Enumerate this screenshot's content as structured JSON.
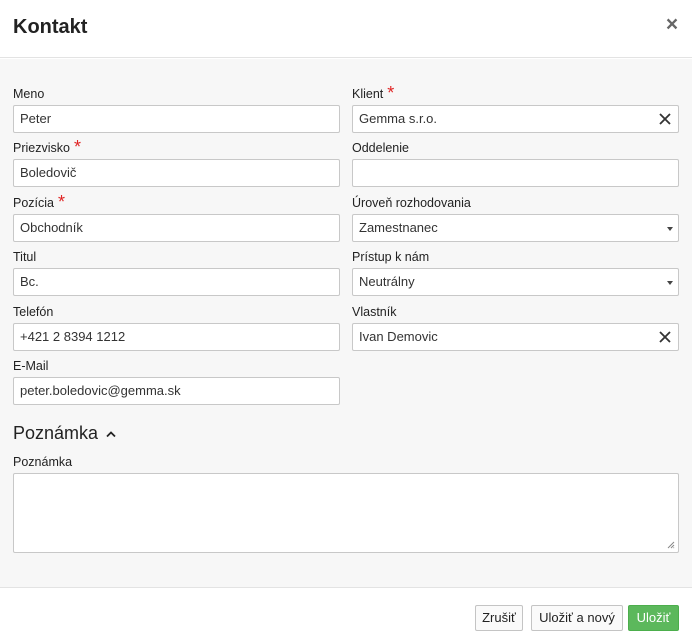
{
  "dialog": {
    "title": "Kontakt",
    "close_symbol": "×"
  },
  "form": {
    "meno": {
      "label": "Meno",
      "value": "Peter"
    },
    "klient": {
      "label": "Klient",
      "required_mark": "*",
      "value": "Gemma s.r.o."
    },
    "priezvisko": {
      "label": "Priezvisko",
      "required_mark": "*",
      "value": "Boledovič"
    },
    "oddelenie": {
      "label": "Oddelenie",
      "value": ""
    },
    "pozicia": {
      "label": "Pozícia",
      "required_mark": "*",
      "value": "Obchodník"
    },
    "uroven": {
      "label": "Úroveň rozhodovania",
      "value": "Zamestnanec"
    },
    "titul": {
      "label": "Titul",
      "value": "Bc."
    },
    "pristup": {
      "label": "Prístup k nám",
      "value": "Neutrálny"
    },
    "telefon": {
      "label": "Telefón",
      "value": "+421 2 8394 1212"
    },
    "vlastnik": {
      "label": "Vlastník",
      "value": "Ivan Demovic"
    },
    "email": {
      "label": "E-Mail",
      "value": "peter.boledovic@gemma.sk"
    }
  },
  "note_section": {
    "title": "Poznámka",
    "field_label": "Poznámka",
    "value": ""
  },
  "footer": {
    "cancel_label": "Zrušiť",
    "save_new_label": "Uložiť a nový",
    "save_label": "Uložiť"
  },
  "colors": {
    "required": "#e02424",
    "primary_button": "#5cb85c",
    "body_bg": "#f7f7f7"
  },
  "icons": {
    "close": "close-icon",
    "clear": "clear-icon",
    "dropdown": "caret-down-icon",
    "collapse": "chevron-up-icon",
    "resize": "resize-grip-icon"
  }
}
